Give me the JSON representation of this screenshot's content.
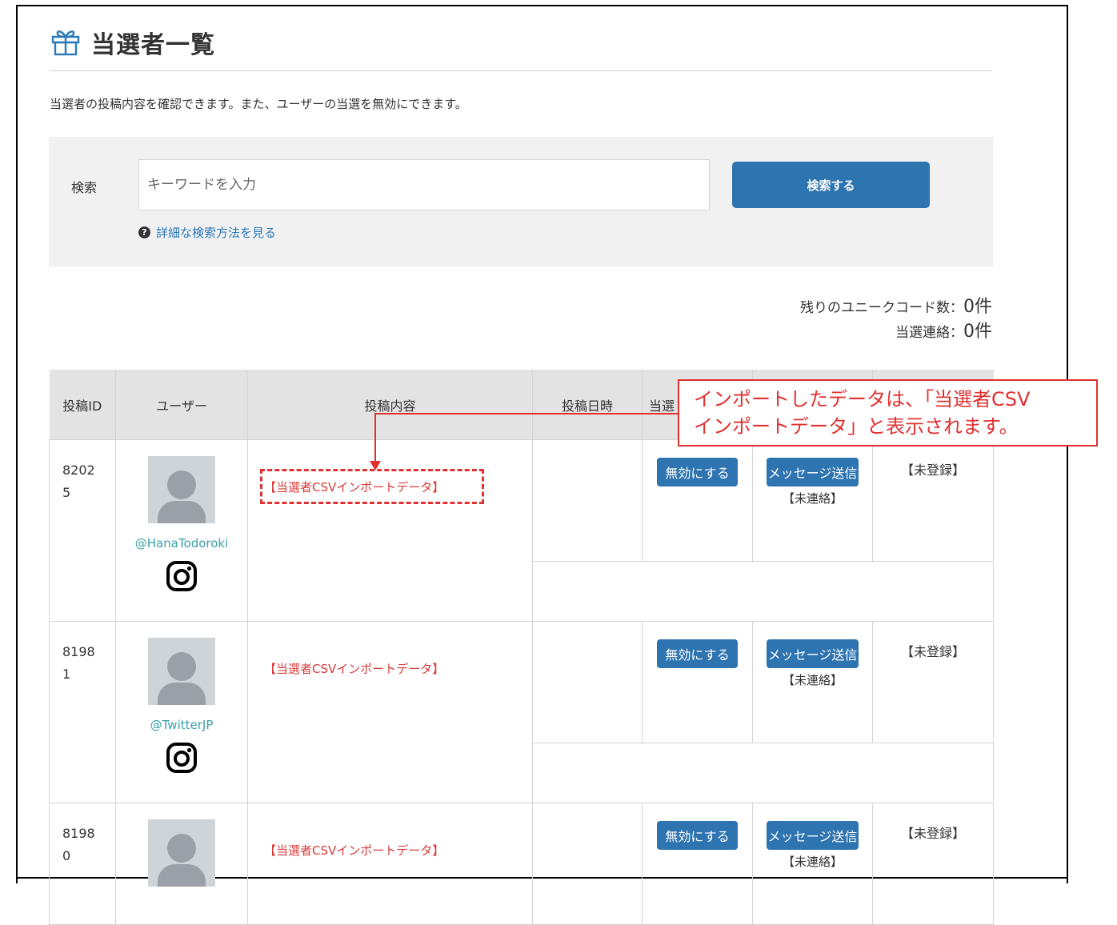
{
  "page": {
    "title": "当選者一覧",
    "description": "当選者の投稿内容を確認できます。また、ユーザーの当選を無効にできます。"
  },
  "search": {
    "label": "検索",
    "placeholder": "キーワードを入力",
    "button_label": "検索する",
    "help_link": "詳細な検索方法を見る"
  },
  "counts": {
    "unique_label": "残りのユニークコード数：",
    "unique_value": "0件",
    "contact_label": "当選連絡：",
    "contact_value": "0件"
  },
  "table": {
    "headers": [
      "投稿ID",
      "ユーザー",
      "投稿内容",
      "投稿日時",
      "当選"
    ],
    "rows": [
      {
        "id_line1": "8202",
        "id_line2": "5",
        "handle": "@HanaTodoroki",
        "content": "【当選者CSVインポートデータ】",
        "invalidate_label": "無効にする",
        "message_label": "メッセージ送信",
        "contact_status": "【未連絡】",
        "registration": "【未登録】"
      },
      {
        "id_line1": "8198",
        "id_line2": "1",
        "handle": "@TwitterJP",
        "content": "【当選者CSVインポートデータ】",
        "invalidate_label": "無効にする",
        "message_label": "メッセージ送信",
        "contact_status": "【未連絡】",
        "registration": "【未登録】"
      },
      {
        "id_line1": "8198",
        "id_line2": "0",
        "handle": "",
        "content": "【当選者CSVインポートデータ】",
        "invalidate_label": "無効にする",
        "message_label": "メッセージ送信",
        "contact_status": "【未連絡】",
        "registration": "【未登録】"
      }
    ]
  },
  "callout": {
    "line1": "インポートしたデータは、「当選者CSV",
    "line2": "インポートデータ」と表示されます。"
  },
  "icons": {
    "title_icon": "gift-icon",
    "help_icon": "question-circle-icon",
    "platform_icon": "instagram-icon"
  },
  "colors": {
    "primary_button": "#2e74b0",
    "import_text": "#d83a3a",
    "annotation": "#e03030",
    "link": "#2b78b8"
  }
}
